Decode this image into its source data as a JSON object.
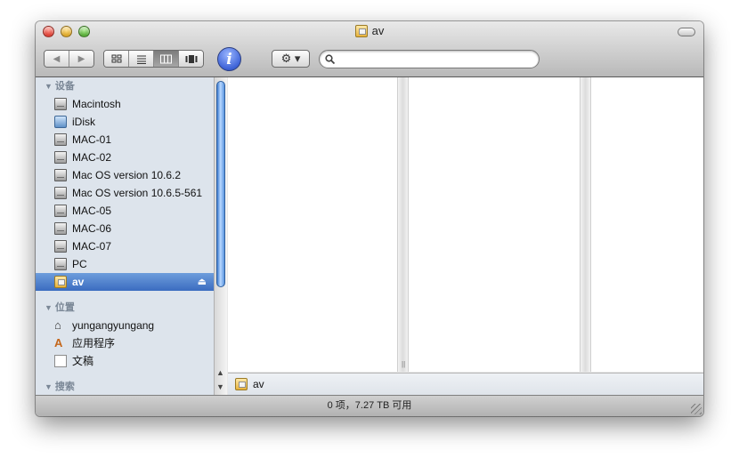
{
  "window": {
    "title": "av"
  },
  "toolbar": {
    "back_label": "◀",
    "forward_label": "▶",
    "view_modes": [
      "icon",
      "list",
      "column",
      "coverflow"
    ],
    "active_view": "column",
    "info_label": "i",
    "action_label": "⚙ ▾",
    "search": {
      "value": "",
      "placeholder": ""
    }
  },
  "sidebar": {
    "devices_header": "设备",
    "devices": [
      {
        "label": "Macintosh",
        "icon": "hard-drive-icon"
      },
      {
        "label": "iDisk",
        "icon": "idisk-icon"
      },
      {
        "label": "MAC-01",
        "icon": "hard-drive-icon"
      },
      {
        "label": "MAC-02",
        "icon": "hard-drive-icon"
      },
      {
        "label": "Mac OS version 10.6.2",
        "icon": "hard-drive-icon"
      },
      {
        "label": "Mac OS version 10.6.5-561",
        "icon": "hard-drive-icon"
      },
      {
        "label": "MAC-05",
        "icon": "hard-drive-icon"
      },
      {
        "label": "MAC-06",
        "icon": "hard-drive-icon"
      },
      {
        "label": "MAC-07",
        "icon": "hard-drive-icon"
      },
      {
        "label": "PC",
        "icon": "hard-drive-icon"
      },
      {
        "label": "av",
        "icon": "network-disk-icon",
        "selected": true,
        "eject": "⏏"
      }
    ],
    "places_header": "位置",
    "places": [
      {
        "label": "yungangyungang",
        "icon": "home-icon"
      },
      {
        "label": "应用程序",
        "icon": "applications-icon"
      },
      {
        "label": "文稿",
        "icon": "documents-icon"
      }
    ],
    "search_header": "搜索"
  },
  "pathbar": {
    "label": "av"
  },
  "status": {
    "text": "0 项，7.27 TB 可用"
  }
}
